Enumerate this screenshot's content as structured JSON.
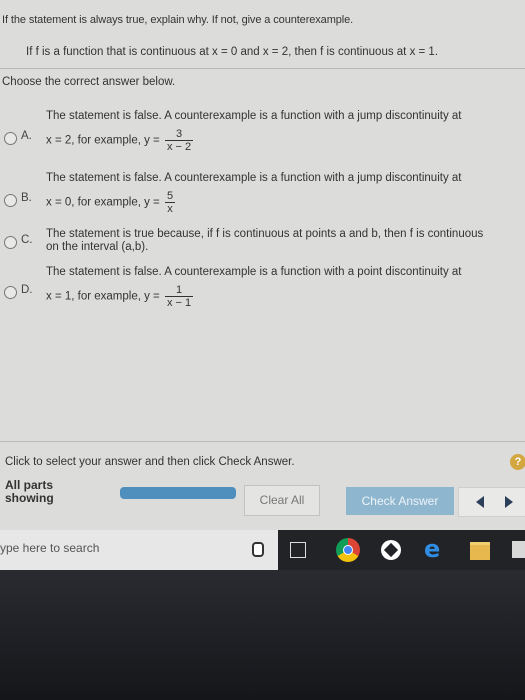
{
  "question": {
    "prompt": "If the statement is always true, explain why. If not, give a counterexample.",
    "statement": "If f is a function that is continuous at x = 0 and x = 2, then f is continuous at x = 1.",
    "instruction": "Choose the correct answer below."
  },
  "options": [
    {
      "letter": "A.",
      "line1": "The statement is false. A counterexample is a function with a jump discontinuity at",
      "line2_prefix": "x = 2, for example, y =",
      "numerator": "3",
      "denominator": "x − 2"
    },
    {
      "letter": "B.",
      "line1": "The statement is false. A counterexample is a function with a jump discontinuity at",
      "line2_prefix": "x = 0, for example, y =",
      "numerator": "5",
      "denominator": "x"
    },
    {
      "letter": "C.",
      "line1": "The statement is true because, if f is continuous at points a and b, then f is continuous",
      "line2_prefix": "on the interval (a,b)."
    },
    {
      "letter": "D.",
      "line1": "The statement is false. A counterexample is a function with a point discontinuity at",
      "line2_prefix": "x = 1, for example, y =",
      "numerator": "1",
      "denominator": "x − 1"
    }
  ],
  "footer": {
    "help_text": "Click to select your answer and then click Check Answer.",
    "help_icon": "?",
    "parts_label": "All parts showing",
    "clear_label": "Clear All",
    "check_label": "Check Answer"
  },
  "taskbar": {
    "search_text": "ype here to search",
    "edge_glyph": "e"
  },
  "colors": {
    "page_bg": "#dcdcda",
    "progress": "#4f8fbe",
    "check_button": "#8eb6cf",
    "help_icon": "#d4a640"
  }
}
